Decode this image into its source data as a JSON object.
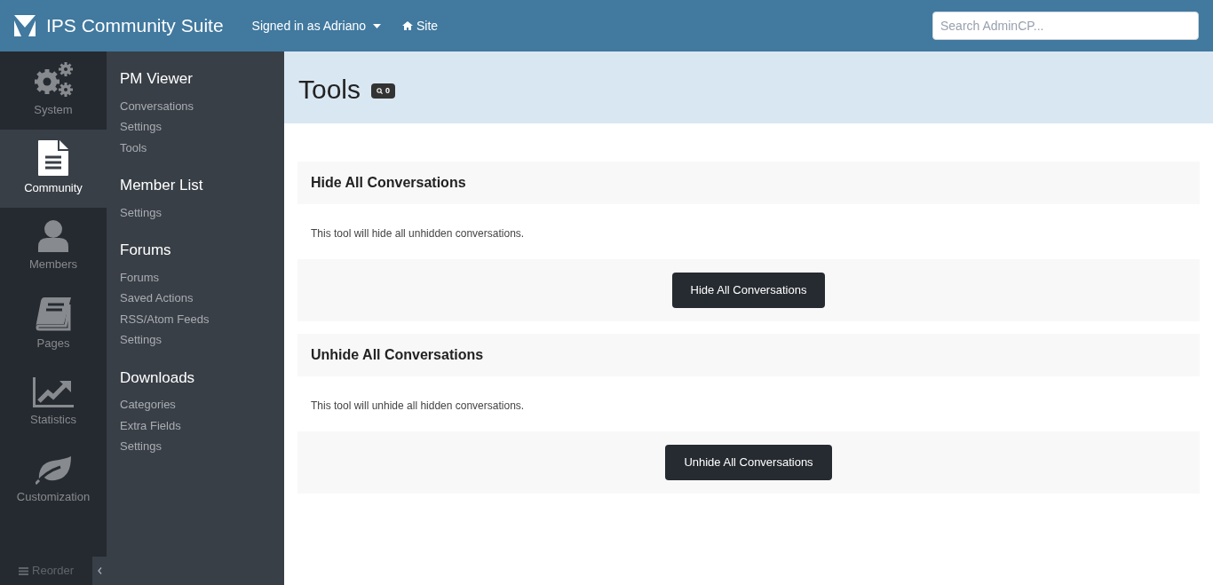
{
  "header": {
    "brand": "IPS Community Suite",
    "user_menu": "Signed in as Adriano",
    "site_link": "Site",
    "search": {
      "placeholder": "Search AdminCP..."
    }
  },
  "apps": [
    {
      "label": "System",
      "kind": "gears",
      "selected": false
    },
    {
      "label": "Community",
      "kind": "document",
      "selected": true
    },
    {
      "label": "Members",
      "kind": "user",
      "selected": false
    },
    {
      "label": "Pages",
      "kind": "book",
      "selected": false
    },
    {
      "label": "Statistics",
      "kind": "chart",
      "selected": false
    },
    {
      "label": "Customization",
      "kind": "leaf",
      "selected": false
    }
  ],
  "reorder": "Reorder",
  "menu_groups": [
    {
      "title": "PM Viewer",
      "items": [
        "Conversations",
        "Settings",
        "Tools"
      ]
    },
    {
      "title": "Member List",
      "items": [
        "Settings"
      ]
    },
    {
      "title": "Forums",
      "items": [
        "Forums",
        "Saved Actions",
        "RSS/Atom Feeds",
        "Settings"
      ]
    },
    {
      "title": "Downloads",
      "items": [
        "Categories",
        "Extra Fields",
        "Settings"
      ]
    }
  ],
  "page": {
    "title": "Tools",
    "badge": "0"
  },
  "sections": [
    {
      "title": "Hide All Conversations",
      "description": "This tool will hide all unhidden conversations.",
      "button": "Hide All Conversations"
    },
    {
      "title": "Unhide All Conversations",
      "description": "This tool will unhide all hidden conversations.",
      "button": "Unhide All Conversations"
    }
  ]
}
